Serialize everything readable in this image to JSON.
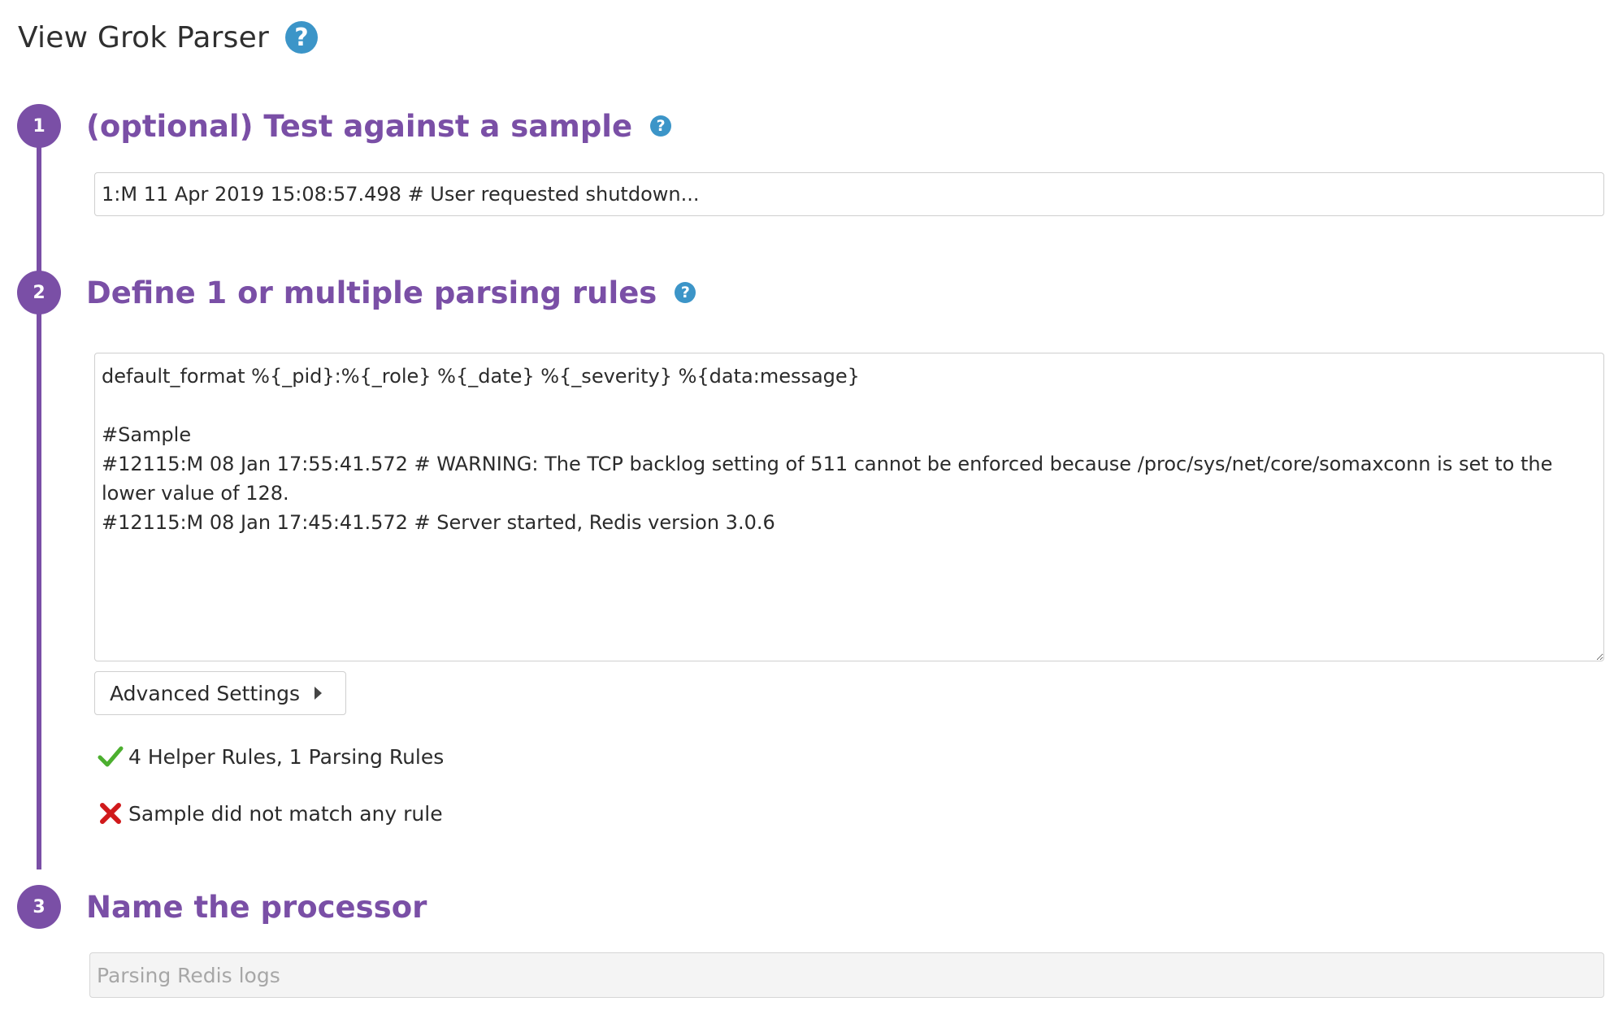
{
  "header": {
    "title": "View Grok Parser",
    "help_icon": "question-circle-icon"
  },
  "steps": [
    {
      "number": "1",
      "title": "(optional) Test against a sample",
      "help_icon": "question-circle-icon"
    },
    {
      "number": "2",
      "title": "Define 1 or multiple parsing rules",
      "help_icon": "question-circle-icon"
    },
    {
      "number": "3",
      "title": "Name the processor"
    }
  ],
  "sample": {
    "value": "1:M 11 Apr 2019 15:08:57.498 # User requested shutdown..."
  },
  "rules": {
    "value": "default_format %{_pid}:%{_role} %{_date} %{_severity} %{data:message}\n\n#Sample\n#12115:M 08 Jan 17:55:41.572 # WARNING: The TCP backlog setting of 511 cannot be enforced because /proc/sys/net/core/somaxconn is set to the lower value of 128.\n#12115:M 08 Jan 17:45:41.572 # Server started, Redis version 3.0.6"
  },
  "advanced_settings": {
    "label": "Advanced Settings",
    "icon": "caret-right-icon"
  },
  "status": {
    "rules_summary": "4 Helper Rules, 1 Parsing Rules",
    "rules_icon": "check-icon",
    "rules_color": "#4caf2f",
    "match_result": "Sample did not match any rule",
    "match_icon": "cross-icon",
    "match_color": "#d0191b"
  },
  "processor_name": {
    "placeholder": "Parsing Redis logs"
  },
  "colors": {
    "accent": "#7a4fa6",
    "help": "#3c95c8"
  }
}
